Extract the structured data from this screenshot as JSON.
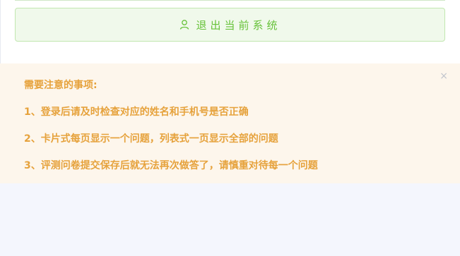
{
  "logout": {
    "label": "退出当前系统",
    "icon": "user-icon"
  },
  "notice": {
    "title": "需要注意的事项:",
    "close_glyph": "×",
    "items": [
      "1、登录后请及时检查对应的姓名和手机号是否正确",
      "2、卡片式每页显示一个问题，列表式一页显示全部的问题",
      "3、评测问卷提交保存后就无法再次做答了，请慎重对待每一个问题"
    ]
  },
  "colors": {
    "success_text": "#67c23a",
    "success_bg": "#f0f9eb",
    "warning_text": "#e6a23c",
    "warning_bg": "#fdf6ec",
    "page_bg": "#f4f6fd"
  }
}
